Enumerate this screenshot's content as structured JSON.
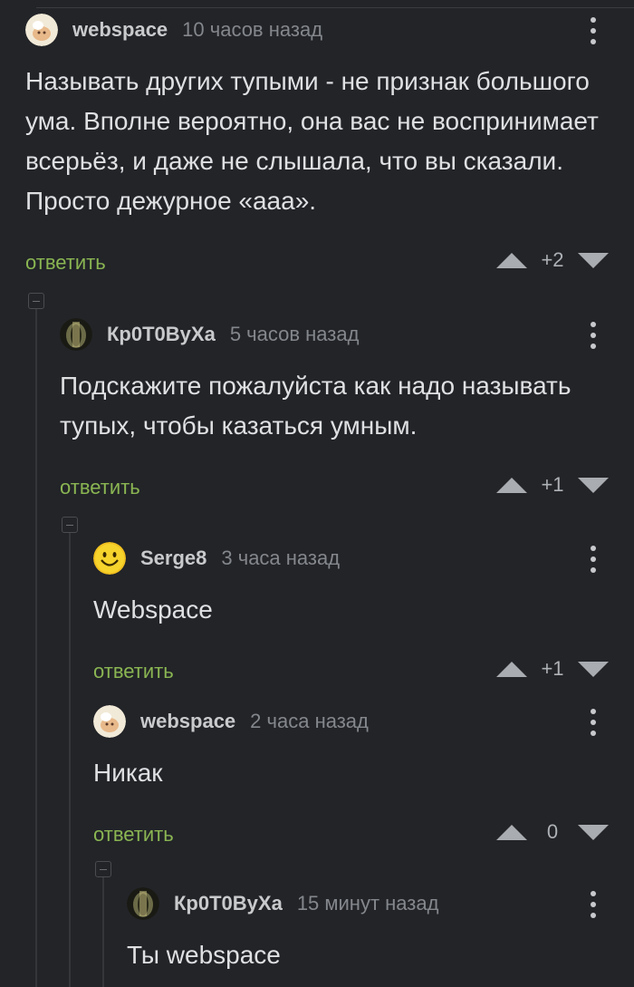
{
  "comments": [
    {
      "author": "webspace",
      "time": "10 часов назад",
      "text": "Называть других тупыми - не признак большого ума. Вполне вероятно, она вас не воспринимает всерьёз, и даже не слышала, что вы сказали. Просто дежурное «ааа».",
      "reply": "ответить",
      "rating": "+2",
      "avatar": "webspace-avatar"
    },
    {
      "author": "Кр0Т0ВуХа",
      "time": "5 часов назад",
      "text": "Подскажите пожалуйста как надо называть тупых, чтобы казаться умным.",
      "reply": "ответить",
      "rating": "+1",
      "avatar": "krotovukha-avatar"
    },
    {
      "author": "Serge8",
      "time": "3 часа назад",
      "text": "Webspace",
      "reply": "ответить",
      "rating": "+1",
      "avatar": "smiley-avatar"
    },
    {
      "author": "webspace",
      "time": "2 часа назад",
      "text": "Никак",
      "reply": "ответить",
      "rating": "0",
      "avatar": "webspace-avatar"
    },
    {
      "author": "Кр0Т0ВуХа",
      "time": "15 минут назад",
      "text": "Ты webspace",
      "reply": "",
      "rating": "",
      "avatar": "krotovukha-avatar"
    }
  ],
  "colors": {
    "background": "#222428",
    "reply": "#8ab552",
    "author": "#c9cacc",
    "time": "#84878c"
  }
}
